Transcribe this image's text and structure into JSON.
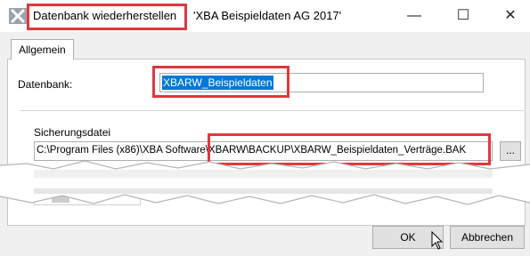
{
  "titlebar": {
    "title": "Datenbank wiederherstellen",
    "database_name": "'XBA Beispieldaten AG 2017'",
    "minimize_symbol": "—",
    "maximize_symbol": "☐",
    "close_symbol": "✕"
  },
  "tabs": [
    {
      "label": "Allgemein"
    }
  ],
  "form": {
    "datenbank_label": "Datenbank:",
    "datenbank_value": "XBARW_Beispieldaten",
    "sicherungsdatei_label": "Sicherungsdatei",
    "sicherungsdatei_value": "C:\\Program Files (x86)\\XBA Software\\XBARW\\BACKUP\\XBARW_Beispieldaten_Verträge.BAK",
    "browse_label": "..."
  },
  "grid": {
    "scroll_left_symbol": "<"
  },
  "buttons": {
    "ok": "OK",
    "cancel": "Abbrechen"
  },
  "colors": {
    "highlight_border": "#e0383d",
    "selection": "#0078d7"
  }
}
